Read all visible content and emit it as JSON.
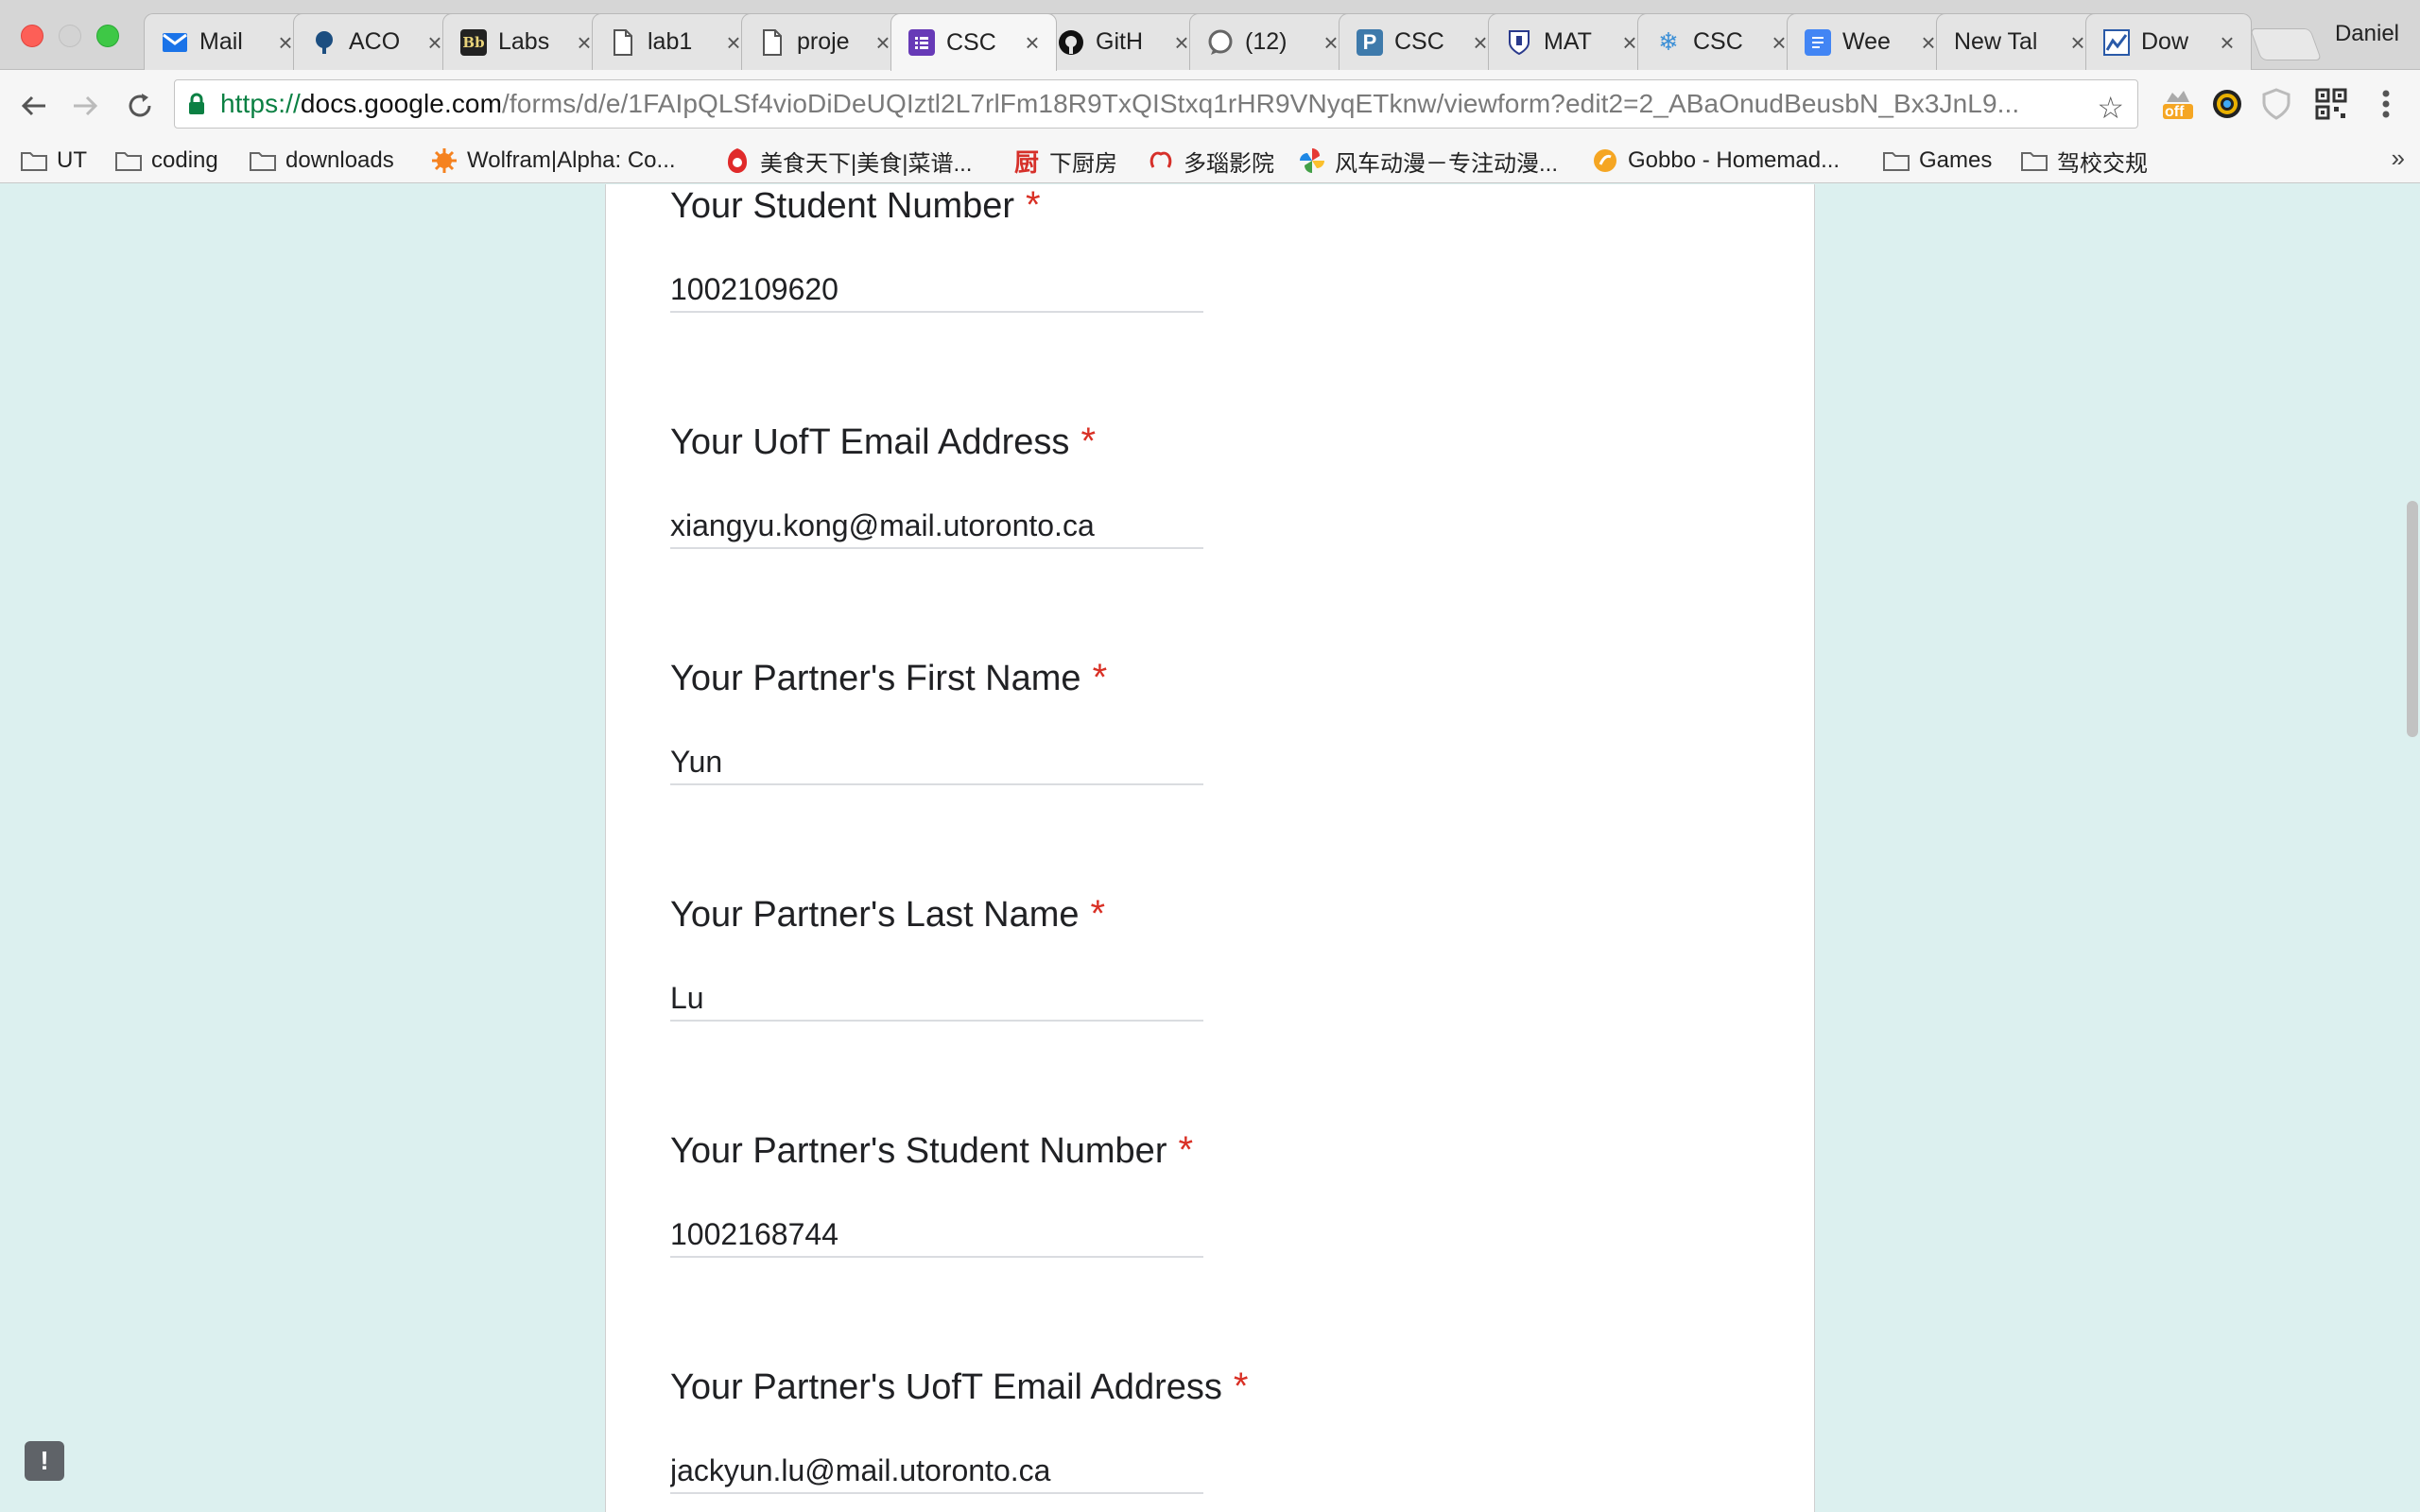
{
  "browser": {
    "profile_name": "Daniel",
    "tabs": [
      {
        "title": "Mail",
        "icon": "mail-icon"
      },
      {
        "title": "ACO",
        "icon": "tree-icon"
      },
      {
        "title": "Labs",
        "icon": "blackboard-icon"
      },
      {
        "title": "lab1",
        "icon": "document-icon"
      },
      {
        "title": "proje",
        "icon": "document-icon"
      },
      {
        "title": "CSC",
        "icon": "google-forms-icon",
        "active": true
      },
      {
        "title": "GitH",
        "icon": "github-icon"
      },
      {
        "title": "(12)",
        "icon": "chat-icon"
      },
      {
        "title": "CSC",
        "icon": "piazza-icon"
      },
      {
        "title": "MAT",
        "icon": "crest-icon"
      },
      {
        "title": "CSC",
        "icon": "snowflake-icon"
      },
      {
        "title": "Wee",
        "icon": "google-docs-icon"
      },
      {
        "title": "New Tal",
        "icon": ""
      },
      {
        "title": "Dow",
        "icon": "chart-icon"
      }
    ],
    "url": {
      "scheme": "https://",
      "host": "docs.google.com",
      "path": "/forms/d/e/1FAIpQLSf4vioDiDeUQIztl2L7rlFm18R9TxQIStxq1rHR9VNyqETknw/viewform?edit2=2_ABaOnudBeusbN_Bx3JnL9..."
    },
    "extension_badge": "off",
    "bookmarks": [
      {
        "label": "UT",
        "icon": "folder-icon"
      },
      {
        "label": "coding",
        "icon": "folder-icon"
      },
      {
        "label": "downloads",
        "icon": "folder-icon"
      },
      {
        "label": "Wolfram|Alpha: Co...",
        "icon": "wolfram-icon"
      },
      {
        "label": "美食天下|美食|菜谱...",
        "icon": "meishi-icon"
      },
      {
        "label": "下厨房",
        "icon": "xiachufang-icon"
      },
      {
        "label": "多瑙影院",
        "icon": "duonao-icon"
      },
      {
        "label": "风车动漫－专注动漫...",
        "icon": "pinwheel-icon"
      },
      {
        "label": "Gobbo - Homemad...",
        "icon": "gobbo-icon"
      },
      {
        "label": "Games",
        "icon": "folder-icon"
      },
      {
        "label": "驾校交规",
        "icon": "folder-icon"
      }
    ],
    "more_bookmarks": "»"
  },
  "form": {
    "questions": [
      {
        "label": "Your Student Number",
        "required_mark": "*",
        "answer": "1002109620"
      },
      {
        "label": "Your UofT Email Address",
        "required_mark": "*",
        "answer": "xiangyu.kong@mail.utoronto.ca"
      },
      {
        "label": "Your Partner's First Name",
        "required_mark": "*",
        "answer": "Yun"
      },
      {
        "label": "Your Partner's Last Name",
        "required_mark": "*",
        "answer": "Lu"
      },
      {
        "label": "Your Partner's Student Number",
        "required_mark": "*",
        "answer": "1002168744"
      },
      {
        "label": "Your Partner's UofT Email Address",
        "required_mark": "*",
        "answer": "jackyun.lu@mail.utoronto.ca"
      }
    ],
    "feedback_icon": "!"
  },
  "colors": {
    "page_background": "#dcf0ef",
    "required": "#d93025",
    "secure_scheme": "#0b8043",
    "forms_purple": "#673ab7"
  }
}
